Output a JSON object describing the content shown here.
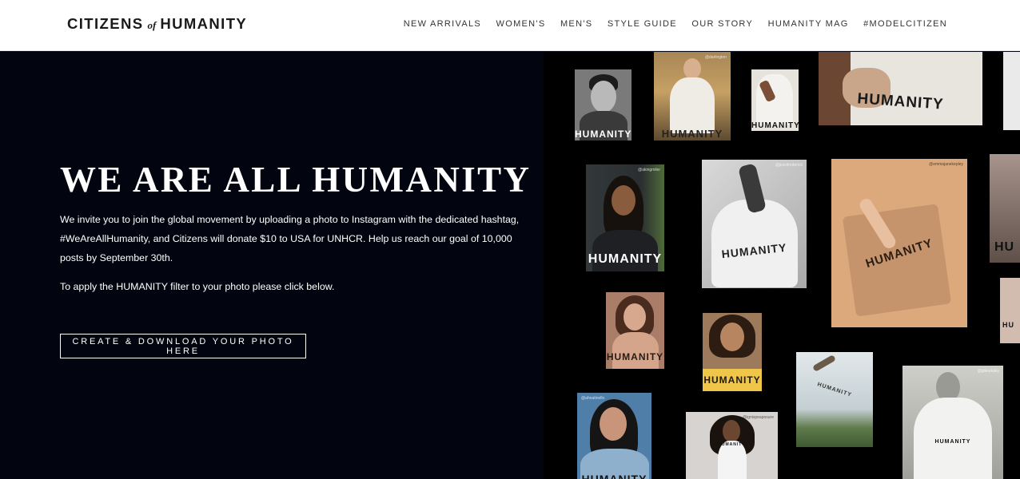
{
  "header": {
    "logo": {
      "part1": "CITIZENS",
      "part2": "of",
      "part3": "HUMANITY"
    },
    "nav": [
      "NEW ARRIVALS",
      "WOMEN'S",
      "MEN'S",
      "STYLE GUIDE",
      "OUR STORY",
      "HUMANITY MAG",
      "#MODELCITIZEN"
    ]
  },
  "hero": {
    "title": "WE ARE ALL HUMANITY",
    "paragraph1": "We invite you to join the global movement by uploading a photo to Instagram with the dedicated hashtag, #WeAreAllHumanity, and Citizens will donate $10 to USA for UNHCR. Help us reach our goal of 10,000 posts by September 30th.",
    "paragraph2": "To apply the HUMANITY filter to your photo please click below.",
    "cta_label": "CREATE & DOWNLOAD YOUR PHOTO HERE"
  },
  "collage": {
    "tiles": [
      {
        "handle": "",
        "text": "HUMANITY",
        "bg": "#6a6a6a"
      },
      {
        "handle": "@darlington",
        "text": "HUMANITY",
        "bg": "#b58a4c"
      },
      {
        "handle": "",
        "text": "HUMANITY",
        "bg": "#d9d4cc"
      },
      {
        "handle": "",
        "text": "HUMANITY",
        "bg": "#d8d2ca"
      },
      {
        "handle": "",
        "text": "",
        "bg": "#e6e6e6"
      },
      {
        "handle": "@akingmiler",
        "text": "HUMANITY",
        "bg": "#2a2f35"
      },
      {
        "handle": "@jessifrederick",
        "text": "HUMANITY",
        "bg": "#c8c8c8"
      },
      {
        "handle": "@emmajanekepley",
        "text": "HUMANITY",
        "bg": "#d9a678"
      },
      {
        "handle": "",
        "text": "HU",
        "bg": "#8b7b74"
      },
      {
        "handle": "",
        "text": "HUMANITY",
        "bg": "#c79a82"
      },
      {
        "handle": "",
        "text": "HUMANITY",
        "bg": "#b88e6c"
      },
      {
        "handle": "",
        "text": "HU",
        "bg": "#c9b5a8"
      },
      {
        "handle": "",
        "text": "HUMANITY",
        "bg": "#cfd7da"
      },
      {
        "handle": "@gilesduley",
        "text": "HUMANITY",
        "bg": "#b6b6b0"
      },
      {
        "handle": "@ahnatinello",
        "text": "HUMANITY",
        "bg": "#4f7fa8"
      },
      {
        "handle": "@ignispeaposure",
        "text": "HUMANITY",
        "bg": "#d5d2cf"
      }
    ]
  },
  "colors": {
    "hero_bg": "#020510",
    "collage_bg": "#000000",
    "header_bg": "#ffffff",
    "text_light": "#ffffff"
  }
}
